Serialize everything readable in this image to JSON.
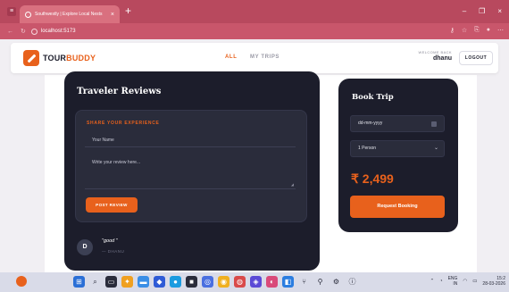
{
  "browser": {
    "tab_title": "Southwestly | Explore Local Nests",
    "tab_close": "×",
    "new_tab": "+",
    "url": "localhost:5173",
    "win_minimize": "–",
    "win_restore": "❐",
    "win_close": "×"
  },
  "nav": {
    "logo_tour": "TOUR",
    "logo_buddy": "BUDDY",
    "all": "ALL",
    "my_trips": "MY TRIPS",
    "welcome_label": "WELCOME BACK",
    "username": "dhanu",
    "logout": "LOGOUT"
  },
  "reviews": {
    "title": "Traveler Reviews",
    "share_heading": "SHARE YOUR EXPERIENCE",
    "name_placeholder": "Your Name",
    "review_placeholder": "Write your review here...",
    "post_button": "POST REVIEW",
    "items": [
      {
        "initial": "D",
        "quote": "\"good \"",
        "author": "— DHANU"
      }
    ]
  },
  "booking": {
    "title": "Book Trip",
    "date_placeholder": "dd-mm-yyyy",
    "persons": "1 Person",
    "price": "₹ 2,499",
    "request_button": "Request Booking"
  },
  "taskbar": {
    "lang_top": "ENG",
    "lang_bottom": "IN",
    "time": "15:2",
    "date": "28-03-2026"
  },
  "colors": {
    "accent": "#e8611c",
    "dark_card": "#1c1d2b",
    "browser": "#b8495e"
  }
}
